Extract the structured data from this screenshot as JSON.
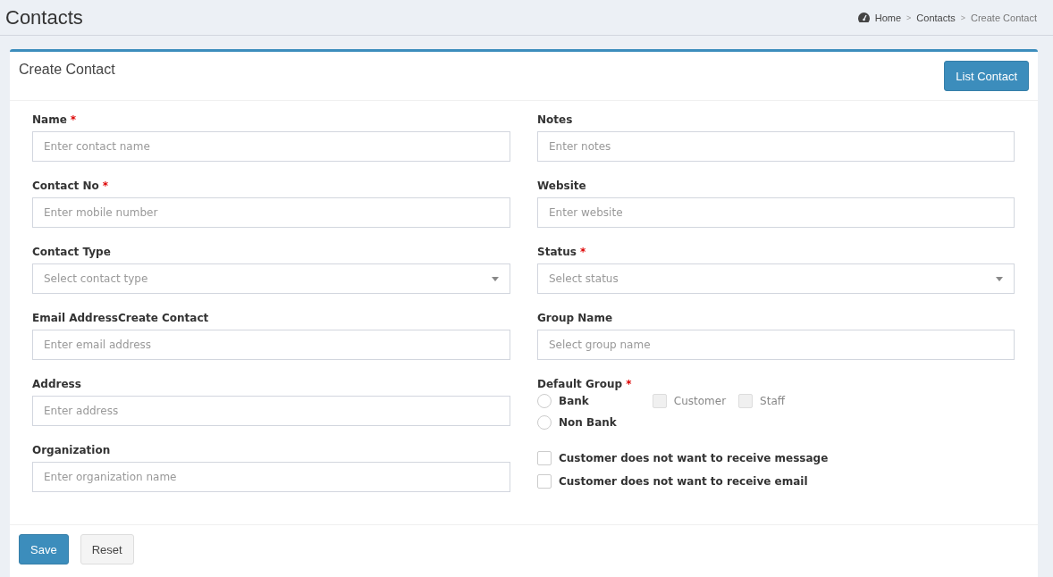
{
  "page": {
    "title": "Contacts"
  },
  "breadcrumb": [
    {
      "label": "Home",
      "current": false
    },
    {
      "separator": ">",
      "label": "Contacts",
      "current": false
    },
    {
      "separator": ">",
      "label": "Create Contact",
      "current": true
    }
  ],
  "card": {
    "title": "Create Contact",
    "list_button": "List Contact"
  },
  "left_fields": [
    {
      "label": "Name",
      "required_mark": "*",
      "placeholder": "Enter contact name",
      "kind": "text"
    },
    {
      "label": "Contact No",
      "required_mark": "*",
      "placeholder": "Enter mobile number",
      "kind": "text"
    },
    {
      "label": "Contact Type",
      "placeholder": "Select contact type",
      "kind": "select"
    },
    {
      "label": "Email AddressCreate Contact",
      "placeholder": "Enter email address",
      "kind": "text"
    },
    {
      "label": "Address",
      "placeholder": "Enter address",
      "kind": "text"
    },
    {
      "label": "Organization",
      "placeholder": "Enter organization name",
      "kind": "text"
    }
  ],
  "right_fields": [
    {
      "label": "Notes",
      "placeholder": "Enter notes",
      "kind": "text"
    },
    {
      "label": "Website",
      "placeholder": "Enter website",
      "kind": "text"
    },
    {
      "label": "Status",
      "required_mark": "*",
      "placeholder": "Select status",
      "kind": "select"
    },
    {
      "label": "Group Name",
      "placeholder": "Select group name",
      "kind": "text"
    }
  ],
  "default_group": {
    "label": "Default Group",
    "required_mark": "*",
    "radios": [
      {
        "label": "Bank",
        "selected": false
      },
      {
        "label": "Non Bank",
        "selected": false
      }
    ],
    "checkboxes": [
      {
        "label": "Customer",
        "checked": false,
        "disabled": true
      },
      {
        "label": "Staff",
        "checked": false,
        "disabled": true
      }
    ]
  },
  "options": [
    {
      "label": "Customer does not want to receive message",
      "checked": false
    },
    {
      "label": "Customer does not want to receive email",
      "checked": false
    }
  ],
  "buttons": {
    "save": "Save",
    "reset": "Reset"
  }
}
